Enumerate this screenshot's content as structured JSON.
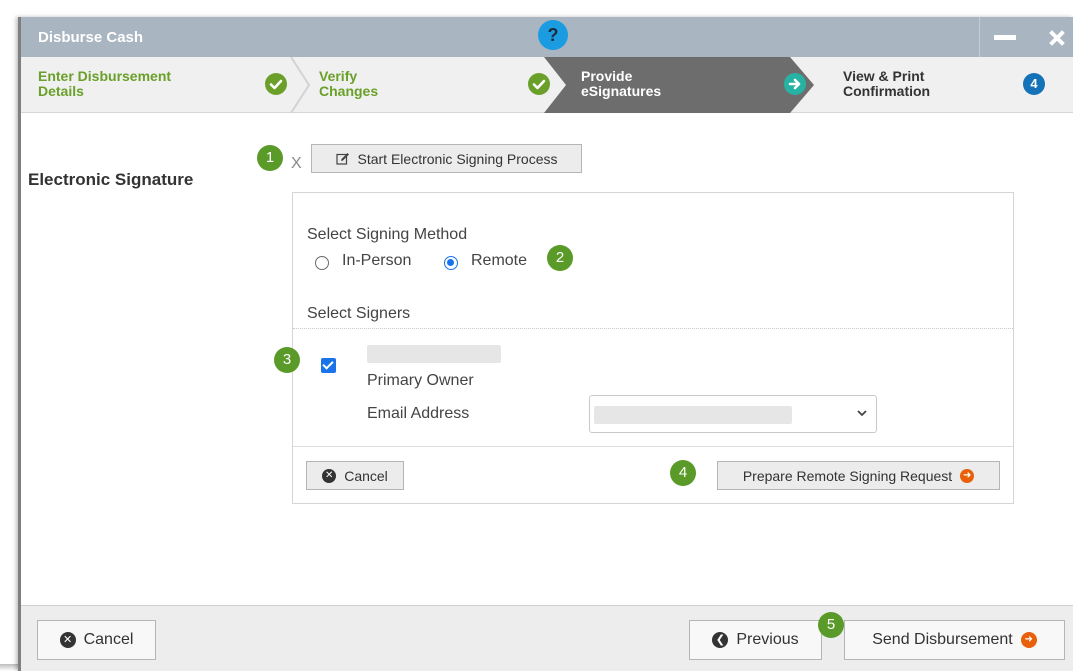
{
  "window": {
    "title": "Disburse Cash",
    "help_label": "?"
  },
  "steps": [
    {
      "label_line1": "Enter Disbursement",
      "label_line2": "Details",
      "status": "complete",
      "icon": "check-icon"
    },
    {
      "label_line1": "Verify",
      "label_line2": "Changes",
      "status": "complete",
      "icon": "check-icon"
    },
    {
      "label_line1": "Provide",
      "label_line2": "eSignatures",
      "status": "active",
      "icon": "arrow-right-icon"
    },
    {
      "label_line1": "View & Print",
      "label_line2": "Confirmation",
      "status": "pending",
      "number": "4"
    }
  ],
  "colors": {
    "titlebar": "#a9b5c1",
    "accent_green": "#6aa029",
    "active_step": "#6d6d6d",
    "help_blue": "#1b9be0",
    "step_number_blue": "#1372b8",
    "orange": "#e8600a",
    "checkbox_blue": "#1a73e8"
  },
  "main": {
    "section_label": "Electronic Signature",
    "x_mark": "X",
    "start_button_label": "Start Electronic Signing Process",
    "signing": {
      "method_label": "Select Signing Method",
      "options": [
        {
          "label": "In-Person",
          "checked": false
        },
        {
          "label": "Remote",
          "checked": true
        }
      ],
      "signers_label": "Select Signers",
      "signer": {
        "checked": true,
        "role": "Primary Owner",
        "email_label": "Email Address"
      }
    },
    "panel_cancel_label": "Cancel",
    "prepare_button_label": "Prepare Remote Signing Request"
  },
  "annotations": [
    "1",
    "2",
    "3",
    "4",
    "5"
  ],
  "footer": {
    "cancel_label": "Cancel",
    "previous_label": "Previous",
    "send_label": "Send Disbursement"
  }
}
